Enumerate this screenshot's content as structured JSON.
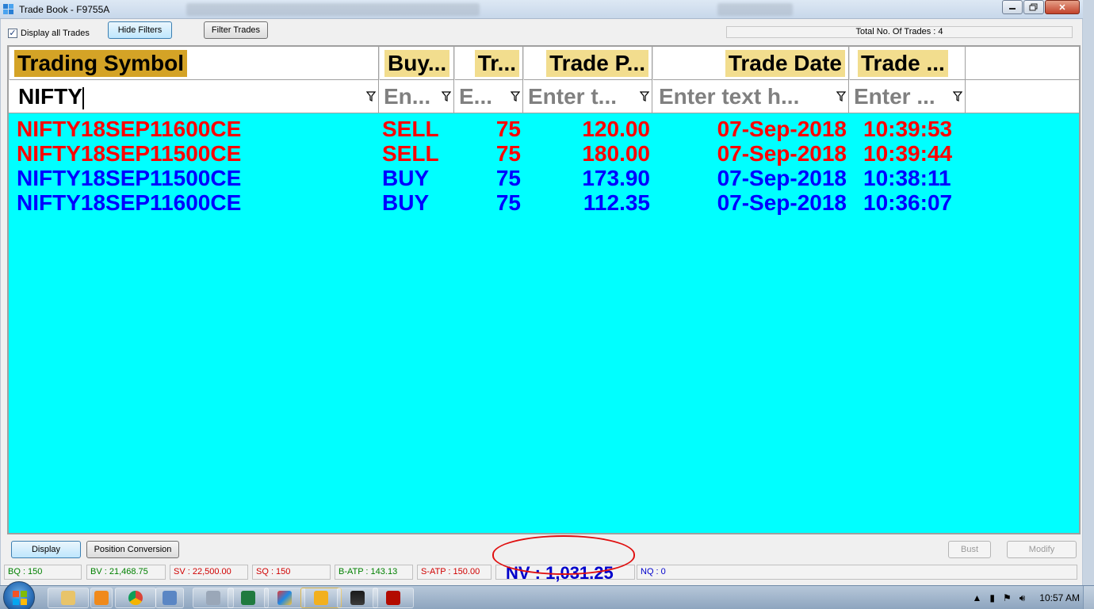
{
  "window": {
    "title": "Trade Book - F9755A"
  },
  "toolbar": {
    "display_all_label": "Display all Trades",
    "display_all_checked": "✓",
    "hide_filters_label": "Hide Filters",
    "filter_trades_label": "Filter Trades",
    "total_trades": "Total No. Of Trades : 4"
  },
  "columns": [
    "Trading Symbol",
    "Buy...",
    "Tr...",
    "Trade P...",
    "Trade Date",
    "Trade ..."
  ],
  "filters": {
    "symbol_value": "NIFTY",
    "placeholders": [
      "En...",
      "E...",
      "Enter t...",
      "Enter text h...",
      "Enter ..."
    ]
  },
  "trades": [
    {
      "symbol": "NIFTY18SEP11600CE",
      "side": "SELL",
      "qty": "75",
      "price": "120.00",
      "date": "07-Sep-2018",
      "time": "10:39:53"
    },
    {
      "symbol": "NIFTY18SEP11500CE",
      "side": "SELL",
      "qty": "75",
      "price": "180.00",
      "date": "07-Sep-2018",
      "time": "10:39:44"
    },
    {
      "symbol": "NIFTY18SEP11500CE",
      "side": "BUY",
      "qty": "75",
      "price": "173.90",
      "date": "07-Sep-2018",
      "time": "10:38:11"
    },
    {
      "symbol": "NIFTY18SEP11600CE",
      "side": "BUY",
      "qty": "75",
      "price": "112.35",
      "date": "07-Sep-2018",
      "time": "10:36:07"
    }
  ],
  "bottom": {
    "display_label": "Display",
    "position_conversion_label": "Position Conversion",
    "bust_label": "Bust",
    "modify_label": "Modify"
  },
  "status": {
    "bq": "BQ : 150",
    "bv": "BV : 21,468.75",
    "sv": "SV : 22,500.00",
    "sq": "SQ : 150",
    "batp": "B-ATP : 143.13",
    "satp": "S-ATP : 150.00",
    "nv": "NV : 1,031.25",
    "nq": "NQ : 0"
  },
  "colors": {
    "grid_bg": "#00ffff",
    "sell": "#ff0000",
    "buy": "#0000ff",
    "header_sel": "#d4a326",
    "header": "#f2dd8e"
  },
  "taskbar": {
    "clock": "10:57 AM"
  }
}
